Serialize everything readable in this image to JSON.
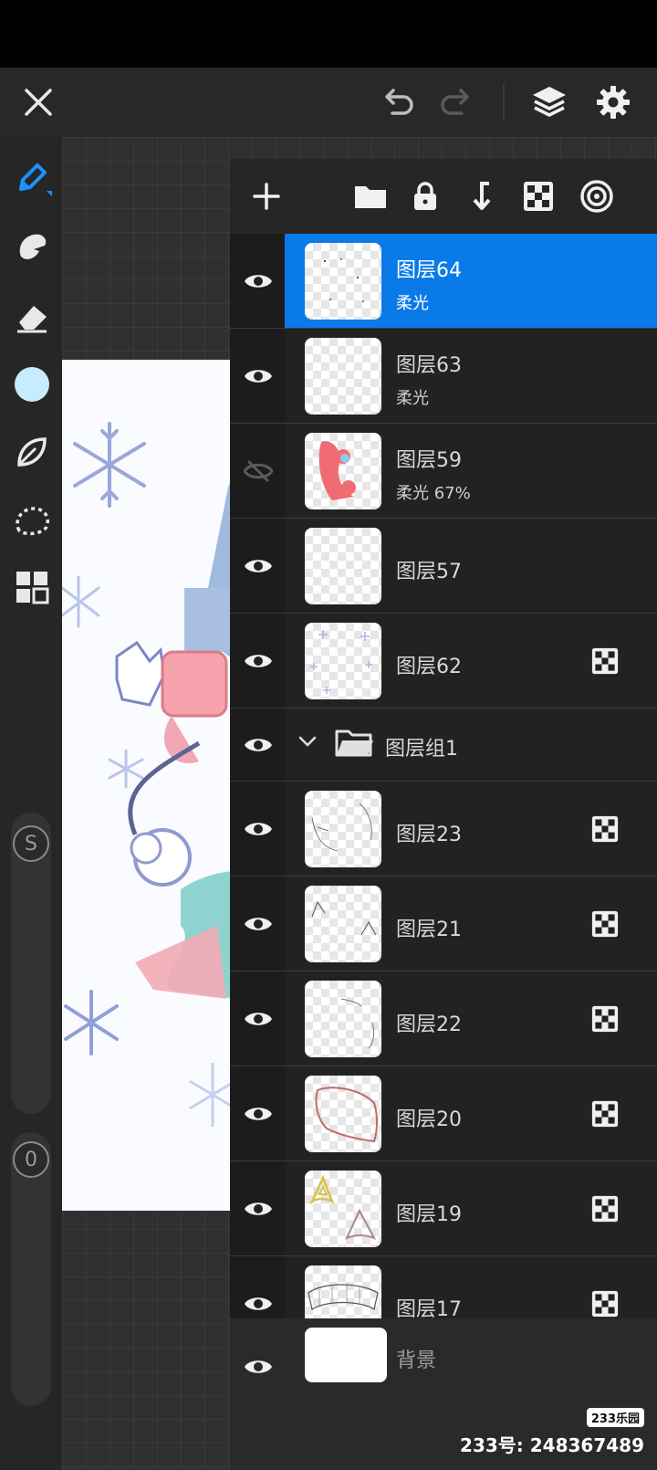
{
  "toolbar": {
    "close_icon": "close-icon",
    "undo_icon": "undo-icon",
    "redo_icon": "redo-icon",
    "layers_icon": "layers-icon",
    "settings_icon": "gear-icon"
  },
  "side_tools": {
    "items": [
      "brush",
      "smudge",
      "eraser",
      "color",
      "liquify",
      "selection",
      "gallery"
    ],
    "active": "brush",
    "color_swatch": "#c7ecfb",
    "size_slider_label": "S",
    "opacity_slider_label": "0"
  },
  "layers_header": {
    "icons": [
      "add-layer",
      "new-group",
      "lock",
      "merge-down",
      "clipping-mask",
      "layer-properties"
    ]
  },
  "layers": [
    {
      "name": "图层64",
      "sub": "柔光",
      "visible": true,
      "selected": true,
      "clip": false
    },
    {
      "name": "图层63",
      "sub": "柔光",
      "visible": true,
      "selected": false,
      "clip": false
    },
    {
      "name": "图层59",
      "sub": "柔光    67%",
      "visible": false,
      "selected": false,
      "clip": false
    },
    {
      "name": "图层57",
      "sub": "",
      "visible": true,
      "selected": false,
      "clip": false
    },
    {
      "name": "图层62",
      "sub": "",
      "visible": true,
      "selected": false,
      "clip": true
    }
  ],
  "group": {
    "name": "图层组1",
    "expanded": true,
    "visible": true
  },
  "group_layers": [
    {
      "name": "图层23",
      "visible": true,
      "clip": true
    },
    {
      "name": "图层21",
      "visible": true,
      "clip": true
    },
    {
      "name": "图层22",
      "visible": true,
      "clip": true
    },
    {
      "name": "图层20",
      "visible": true,
      "clip": true
    },
    {
      "name": "图层19",
      "visible": true,
      "clip": true
    },
    {
      "name": "图层17",
      "visible": true,
      "clip": true
    }
  ],
  "background_layer": {
    "name": "背景",
    "visible": true
  },
  "watermark": {
    "logo": "233乐园",
    "text": "233号: 248367489"
  },
  "colors": {
    "accent": "#0a7ae8",
    "panel": "#212121"
  }
}
